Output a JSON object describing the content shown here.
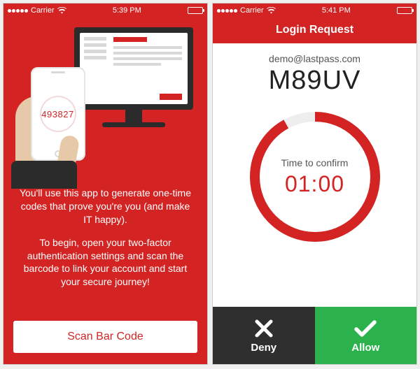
{
  "screen1": {
    "status": {
      "carrier": "Carrier",
      "time": "5:39 PM"
    },
    "illustration": {
      "otp_code": "493827"
    },
    "intro_para1": "You'll use this app to generate one-time codes that prove you're you (and make IT happy).",
    "intro_para2": "To begin, open your two-factor authentication settings and scan the barcode to link your account and start your secure journey!",
    "scan_button_label": "Scan Bar Code"
  },
  "screen2": {
    "status": {
      "carrier": "Carrier",
      "time": "5:41 PM"
    },
    "header_title": "Login Request",
    "email": "demo@lastpass.com",
    "code": "M89UV",
    "confirm_label": "Time to confirm",
    "timer": "01:00",
    "progress_fraction": 0.92,
    "deny_label": "Deny",
    "allow_label": "Allow"
  },
  "colors": {
    "brand_red": "#d32323",
    "allow_green": "#2bb24c",
    "deny_dark": "#2f2f2f"
  }
}
